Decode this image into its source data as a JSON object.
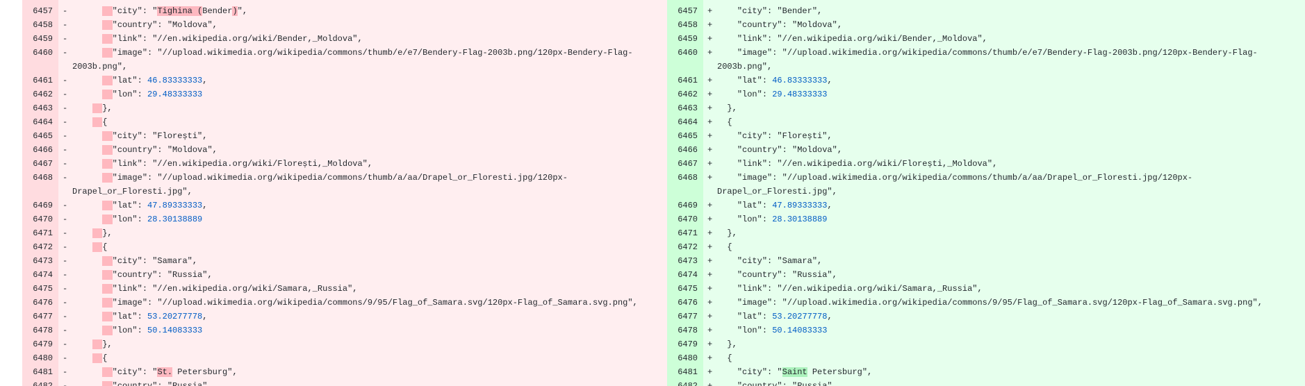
{
  "left": {
    "rows": [
      {
        "ln": "6457",
        "marker": "-",
        "indent": 2,
        "parts": [
          {
            "t": "\"city\": \""
          },
          {
            "t": "Tighina (",
            "c": "del"
          },
          {
            "t": "Bender"
          },
          {
            "t": ")",
            "c": "del"
          },
          {
            "t": "\","
          }
        ]
      },
      {
        "ln": "6458",
        "marker": "-",
        "indent": 2,
        "parts": [
          {
            "t": "\"country\": \"Moldova\","
          }
        ]
      },
      {
        "ln": "6459",
        "marker": "-",
        "indent": 2,
        "parts": [
          {
            "t": "\"link\": \"//en.wikipedia.org/wiki/Bender,_Moldova\","
          }
        ]
      },
      {
        "ln": "6460",
        "marker": "-",
        "indent": 2,
        "parts": [
          {
            "t": "\"image\": \"//upload.wikimedia.org/wikipedia/commons/thumb/e/e7/Bendery-Flag-2003b.png/120px-Bendery-Flag-2003b.png\","
          }
        ]
      },
      {
        "ln": "6461",
        "marker": "-",
        "indent": 2,
        "parts": [
          {
            "t": "\"lat\": "
          },
          {
            "t": "46.83333333",
            "c": "n"
          },
          {
            "t": ","
          }
        ]
      },
      {
        "ln": "6462",
        "marker": "-",
        "indent": 2,
        "parts": [
          {
            "t": "\"lon\": "
          },
          {
            "t": "29.48333333",
            "c": "n"
          }
        ]
      },
      {
        "ln": "6463",
        "marker": "-",
        "indent": 1,
        "parts": [
          {
            "t": "},"
          }
        ]
      },
      {
        "ln": "6464",
        "marker": "-",
        "indent": 1,
        "parts": [
          {
            "t": "{"
          }
        ]
      },
      {
        "ln": "6465",
        "marker": "-",
        "indent": 2,
        "parts": [
          {
            "t": "\"city\": \"Florești\","
          }
        ]
      },
      {
        "ln": "6466",
        "marker": "-",
        "indent": 2,
        "parts": [
          {
            "t": "\"country\": \"Moldova\","
          }
        ]
      },
      {
        "ln": "6467",
        "marker": "-",
        "indent": 2,
        "parts": [
          {
            "t": "\"link\": \"//en.wikipedia.org/wiki/Florești,_Moldova\","
          }
        ]
      },
      {
        "ln": "6468",
        "marker": "-",
        "indent": 2,
        "parts": [
          {
            "t": "\"image\": \"//upload.wikimedia.org/wikipedia/commons/thumb/a/aa/Drapel_or_Floresti.jpg/120px-Drapel_or_Floresti.jpg\","
          }
        ]
      },
      {
        "ln": "6469",
        "marker": "-",
        "indent": 2,
        "parts": [
          {
            "t": "\"lat\": "
          },
          {
            "t": "47.89333333",
            "c": "n"
          },
          {
            "t": ","
          }
        ]
      },
      {
        "ln": "6470",
        "marker": "-",
        "indent": 2,
        "parts": [
          {
            "t": "\"lon\": "
          },
          {
            "t": "28.30138889",
            "c": "n"
          }
        ]
      },
      {
        "ln": "6471",
        "marker": "-",
        "indent": 1,
        "parts": [
          {
            "t": "},"
          }
        ]
      },
      {
        "ln": "6472",
        "marker": "-",
        "indent": 1,
        "parts": [
          {
            "t": "{"
          }
        ]
      },
      {
        "ln": "6473",
        "marker": "-",
        "indent": 2,
        "parts": [
          {
            "t": "\"city\": \"Samara\","
          }
        ]
      },
      {
        "ln": "6474",
        "marker": "-",
        "indent": 2,
        "parts": [
          {
            "t": "\"country\": \"Russia\","
          }
        ]
      },
      {
        "ln": "6475",
        "marker": "-",
        "indent": 2,
        "parts": [
          {
            "t": "\"link\": \"//en.wikipedia.org/wiki/Samara,_Russia\","
          }
        ]
      },
      {
        "ln": "6476",
        "marker": "-",
        "indent": 2,
        "parts": [
          {
            "t": "\"image\": \"//upload.wikimedia.org/wikipedia/commons/9/95/Flag_of_Samara.svg/120px-Flag_of_Samara.svg.png\","
          }
        ]
      },
      {
        "ln": "6477",
        "marker": "-",
        "indent": 2,
        "parts": [
          {
            "t": "\"lat\": "
          },
          {
            "t": "53.20277778",
            "c": "n"
          },
          {
            "t": ","
          }
        ]
      },
      {
        "ln": "6478",
        "marker": "-",
        "indent": 2,
        "parts": [
          {
            "t": "\"lon\": "
          },
          {
            "t": "50.14083333",
            "c": "n"
          }
        ]
      },
      {
        "ln": "6479",
        "marker": "-",
        "indent": 1,
        "parts": [
          {
            "t": "},"
          }
        ]
      },
      {
        "ln": "6480",
        "marker": "-",
        "indent": 1,
        "parts": [
          {
            "t": "{"
          }
        ]
      },
      {
        "ln": "6481",
        "marker": "-",
        "indent": 2,
        "parts": [
          {
            "t": "\"city\": \""
          },
          {
            "t": "St.",
            "c": "del"
          },
          {
            "t": " Petersburg\","
          }
        ]
      },
      {
        "ln": "6482",
        "marker": "-",
        "indent": 2,
        "parts": [
          {
            "t": "\"country\": \"Russia\","
          }
        ]
      }
    ]
  },
  "right": {
    "rows": [
      {
        "ln": "6457",
        "marker": "+",
        "indent": 2,
        "parts": [
          {
            "t": "\"city\": \"Bender\","
          }
        ]
      },
      {
        "ln": "6458",
        "marker": "+",
        "indent": 2,
        "parts": [
          {
            "t": "\"country\": \"Moldova\","
          }
        ]
      },
      {
        "ln": "6459",
        "marker": "+",
        "indent": 2,
        "parts": [
          {
            "t": "\"link\": \"//en.wikipedia.org/wiki/Bender,_Moldova\","
          }
        ]
      },
      {
        "ln": "6460",
        "marker": "+",
        "indent": 2,
        "parts": [
          {
            "t": "\"image\": \"//upload.wikimedia.org/wikipedia/commons/thumb/e/e7/Bendery-Flag-2003b.png/120px-Bendery-Flag-2003b.png\","
          }
        ]
      },
      {
        "ln": "6461",
        "marker": "+",
        "indent": 2,
        "parts": [
          {
            "t": "\"lat\": "
          },
          {
            "t": "46.83333333",
            "c": "n"
          },
          {
            "t": ","
          }
        ]
      },
      {
        "ln": "6462",
        "marker": "+",
        "indent": 2,
        "parts": [
          {
            "t": "\"lon\": "
          },
          {
            "t": "29.48333333",
            "c": "n"
          }
        ]
      },
      {
        "ln": "6463",
        "marker": "+",
        "indent": 1,
        "parts": [
          {
            "t": "},"
          }
        ]
      },
      {
        "ln": "6464",
        "marker": "+",
        "indent": 1,
        "parts": [
          {
            "t": "{"
          }
        ]
      },
      {
        "ln": "6465",
        "marker": "+",
        "indent": 2,
        "parts": [
          {
            "t": "\"city\": \"Florești\","
          }
        ]
      },
      {
        "ln": "6466",
        "marker": "+",
        "indent": 2,
        "parts": [
          {
            "t": "\"country\": \"Moldova\","
          }
        ]
      },
      {
        "ln": "6467",
        "marker": "+",
        "indent": 2,
        "parts": [
          {
            "t": "\"link\": \"//en.wikipedia.org/wiki/Florești,_Moldova\","
          }
        ]
      },
      {
        "ln": "6468",
        "marker": "+",
        "indent": 2,
        "parts": [
          {
            "t": "\"image\": \"//upload.wikimedia.org/wikipedia/commons/thumb/a/aa/Drapel_or_Floresti.jpg/120px-Drapel_or_Floresti.jpg\","
          }
        ]
      },
      {
        "ln": "6469",
        "marker": "+",
        "indent": 2,
        "parts": [
          {
            "t": "\"lat\": "
          },
          {
            "t": "47.89333333",
            "c": "n"
          },
          {
            "t": ","
          }
        ]
      },
      {
        "ln": "6470",
        "marker": "+",
        "indent": 2,
        "parts": [
          {
            "t": "\"lon\": "
          },
          {
            "t": "28.30138889",
            "c": "n"
          }
        ]
      },
      {
        "ln": "6471",
        "marker": "+",
        "indent": 1,
        "parts": [
          {
            "t": "},"
          }
        ]
      },
      {
        "ln": "6472",
        "marker": "+",
        "indent": 1,
        "parts": [
          {
            "t": "{"
          }
        ]
      },
      {
        "ln": "6473",
        "marker": "+",
        "indent": 2,
        "parts": [
          {
            "t": "\"city\": \"Samara\","
          }
        ]
      },
      {
        "ln": "6474",
        "marker": "+",
        "indent": 2,
        "parts": [
          {
            "t": "\"country\": \"Russia\","
          }
        ]
      },
      {
        "ln": "6475",
        "marker": "+",
        "indent": 2,
        "parts": [
          {
            "t": "\"link\": \"//en.wikipedia.org/wiki/Samara,_Russia\","
          }
        ]
      },
      {
        "ln": "6476",
        "marker": "+",
        "indent": 2,
        "parts": [
          {
            "t": "\"image\": \"//upload.wikimedia.org/wikipedia/commons/9/95/Flag_of_Samara.svg/120px-Flag_of_Samara.svg.png\","
          }
        ]
      },
      {
        "ln": "6477",
        "marker": "+",
        "indent": 2,
        "parts": [
          {
            "t": "\"lat\": "
          },
          {
            "t": "53.20277778",
            "c": "n"
          },
          {
            "t": ","
          }
        ]
      },
      {
        "ln": "6478",
        "marker": "+",
        "indent": 2,
        "parts": [
          {
            "t": "\"lon\": "
          },
          {
            "t": "50.14083333",
            "c": "n"
          }
        ]
      },
      {
        "ln": "6479",
        "marker": "+",
        "indent": 1,
        "parts": [
          {
            "t": "},"
          }
        ]
      },
      {
        "ln": "6480",
        "marker": "+",
        "indent": 1,
        "parts": [
          {
            "t": "{"
          }
        ]
      },
      {
        "ln": "6481",
        "marker": "+",
        "indent": 2,
        "parts": [
          {
            "t": "\"city\": \""
          },
          {
            "t": "Saint",
            "c": "add"
          },
          {
            "t": " Petersburg\","
          }
        ]
      },
      {
        "ln": "6482",
        "marker": "+",
        "indent": 2,
        "parts": [
          {
            "t": "\"country\": \"Russia\","
          }
        ]
      }
    ]
  }
}
